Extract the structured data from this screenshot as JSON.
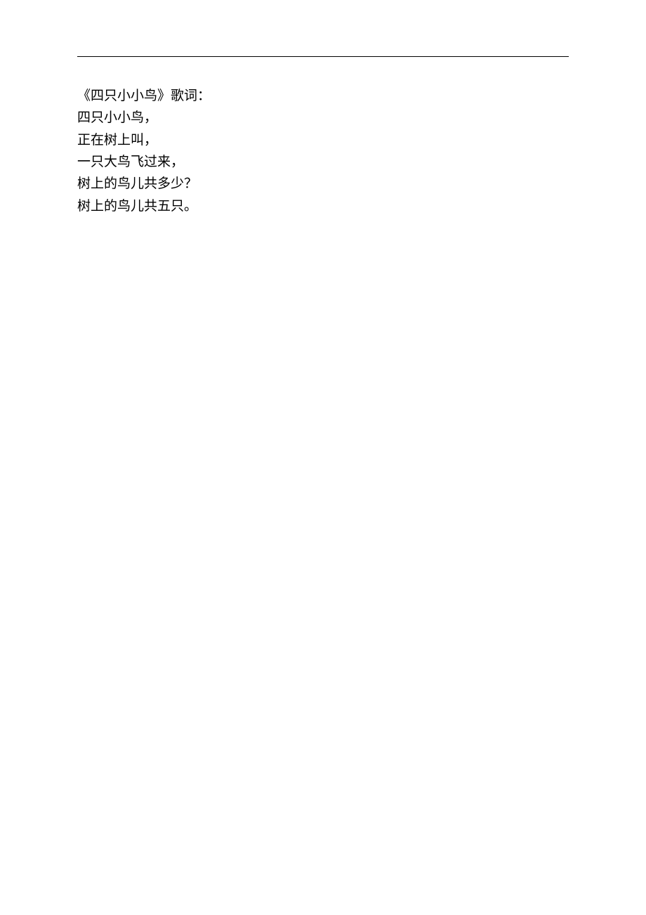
{
  "title": "《四只小小鸟》歌词：",
  "lines": [
    "四只小小鸟，",
    "正在树上叫，",
    "一只大鸟飞过来，",
    "树上的鸟儿共多少？",
    "树上的鸟儿共五只。"
  ]
}
